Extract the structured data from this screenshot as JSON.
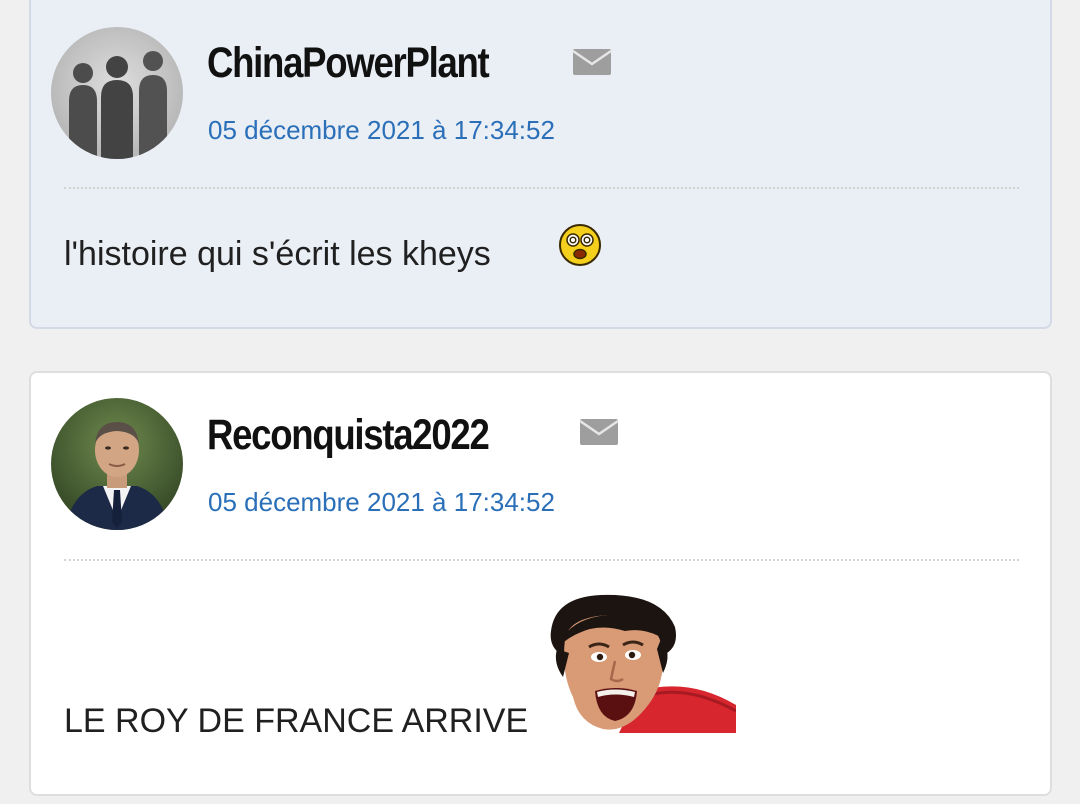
{
  "posts": [
    {
      "author": "ChinaPowerPlant",
      "date": "05 décembre 2021 à 17:34:52",
      "message": "l'histoire qui s'écrit les kheys",
      "avatar": "three-silhouettes-avatar",
      "attachment": "shocked-smiley-icon"
    },
    {
      "author": "Reconquista2022",
      "date": "05 décembre 2021 à 17:34:52",
      "message": "LE ROY DE FRANCE ARRIVE",
      "avatar": "suited-man-avatar",
      "attachment": "laughing-man-sticker"
    }
  ],
  "icons": {
    "private_message": "envelope-icon"
  },
  "colors": {
    "page_background": "#f0f0f0",
    "highlighted_post_background": "#eaeff6",
    "post_background": "#ffffff",
    "date_link": "#2a6fb7",
    "author_text": "#111111",
    "message_text": "#202020"
  }
}
